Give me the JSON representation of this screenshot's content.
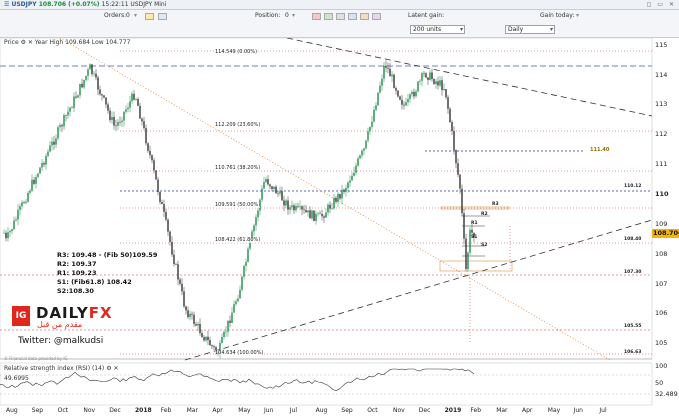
{
  "topbar": {
    "symbol": "USDJPY",
    "price": "108.706 (+0.07%)",
    "time": "15:22:11 USDJPY Mini",
    "window_icons": "◻ ▭ ✕"
  },
  "toolbar": {
    "orders_label": "Orders:",
    "orders_value": "0",
    "position_label": "Position:",
    "position_value": "0",
    "latent_gain_label": "Latent gain:",
    "gain_today_label": "Gain today:",
    "units_value": "200 units",
    "timeframe_value": "Daily"
  },
  "chart": {
    "price_title": "Price",
    "year_hl": "Year High 109.684 Low 104.777",
    "rsi_title": "Relative strength index (RSI) (14)",
    "rsi_left_value": "49.6995",
    "copyright": "© Financial data provided by IG",
    "last_price": "108.706",
    "target_label": "111.40",
    "y_ticks": [
      "115",
      "114",
      "113",
      "112",
      "111",
      "110",
      "109",
      "108",
      "107",
      "106",
      "105",
      "100",
      "50"
    ],
    "rsi_right_value": "32.489",
    "x_ticks": [
      "Aug",
      "Sep",
      "Oct",
      "Nov",
      "Dec",
      "2018",
      "Feb",
      "Mar",
      "Apr",
      "May",
      "Jun",
      "Jul",
      "Aug",
      "Sep",
      "Oct",
      "Nov",
      "Dec",
      "2019",
      "Feb",
      "Mar",
      "Apr",
      "May",
      "Jun",
      "Jul"
    ],
    "fib_levels": [
      "114.549 (0.00%)",
      "112.209 (23.60%)",
      "110.761 (38.20%)",
      "109.591 (50.00%)",
      "108.422 (61.80%)",
      "104.634 (100.00%)"
    ],
    "right_tags": [
      "110.12",
      "108.40",
      "107.30",
      "105.55",
      "106.63"
    ],
    "pivot_markers": [
      "R3",
      "R2",
      "R1",
      "S1",
      "S2"
    ],
    "notes": [
      "R3: 109.48 - (Fib 50)109.59",
      "R2: 109.37",
      "R1: 109.23",
      "S1: (Fib61.8) 108.42",
      "S2:108.30"
    ],
    "brand_prefix": "IG",
    "brand_main": "DAILY",
    "brand_fx": "FX",
    "brand_arabic": "مقدم من قبل",
    "twitter": "Twitter: @malkudsi",
    "colors": {
      "up_candle": "#1e8a4a",
      "down_candle": "#333333",
      "trend_dash": "#333333",
      "fib_dot": "#cc3333",
      "blue_dot": "#2233aa",
      "diag_orange": "#d07a2a",
      "last_price_bg": "#f5b400"
    }
  }
}
